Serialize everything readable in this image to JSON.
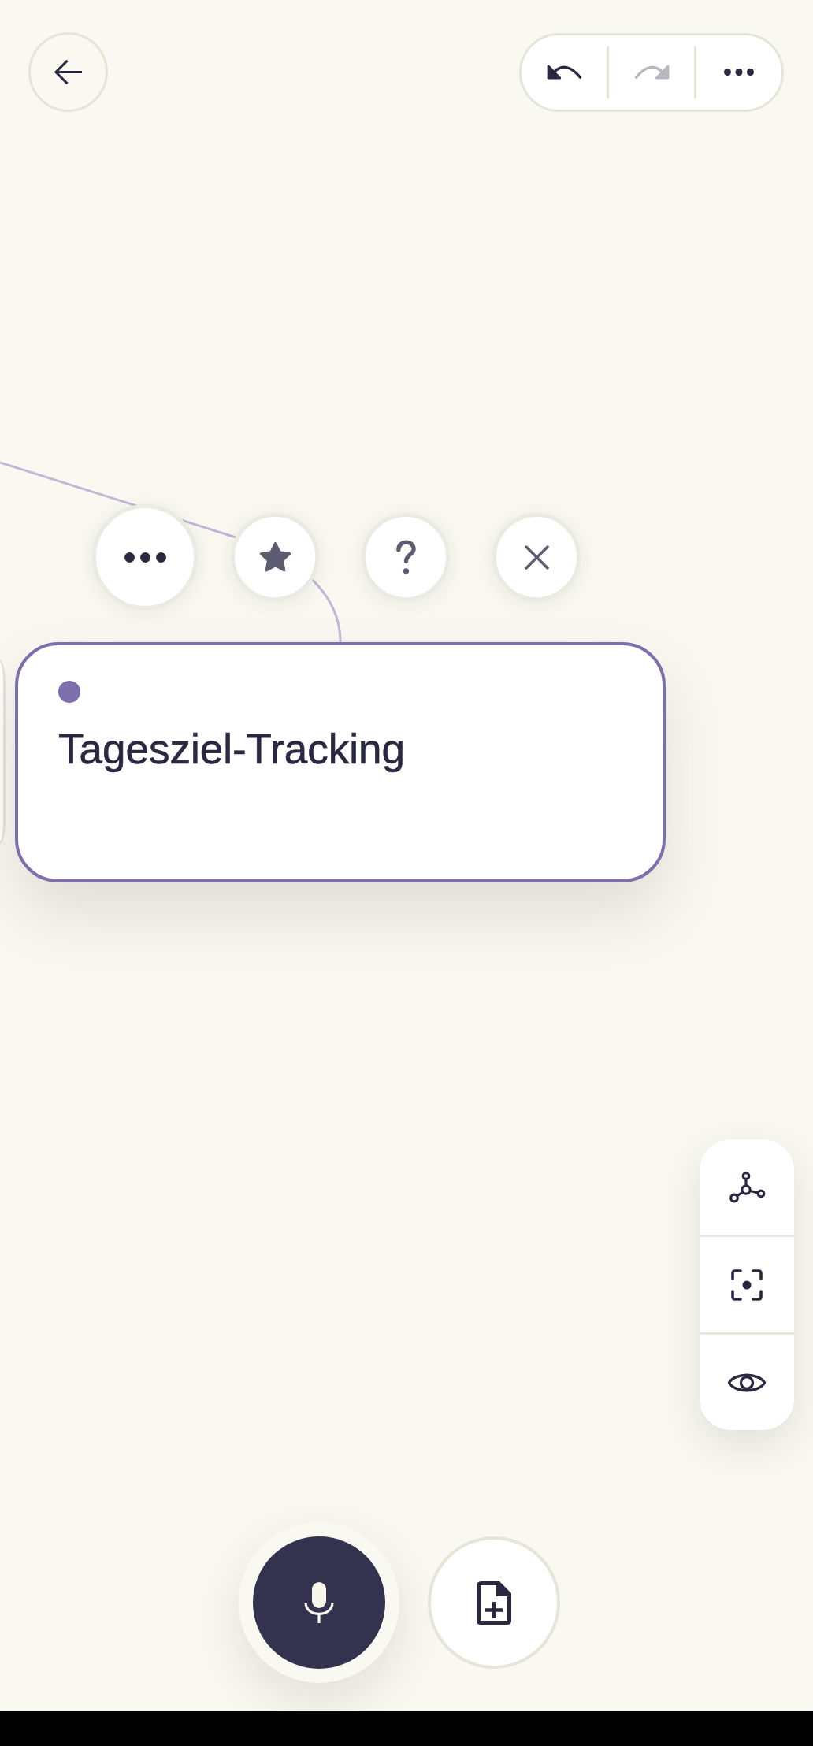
{
  "header": {
    "buttons": [
      {
        "kind": "undo",
        "disabled": false
      },
      {
        "kind": "redo",
        "disabled": true
      },
      {
        "kind": "more",
        "disabled": false
      }
    ]
  },
  "canvas": {
    "nodes": [
      {
        "title": "Tagesziel-Tracking",
        "selected": true,
        "color": "#7f6eac"
      }
    ],
    "node_actions": [
      {
        "kind": "more"
      },
      {
        "kind": "star"
      },
      {
        "kind": "help"
      },
      {
        "kind": "close"
      }
    ]
  },
  "view_controls": [
    {
      "kind": "graph"
    },
    {
      "kind": "focus"
    },
    {
      "kind": "visibility"
    }
  ],
  "bottom_actions": [
    {
      "kind": "record"
    },
    {
      "kind": "add_document"
    }
  ]
}
